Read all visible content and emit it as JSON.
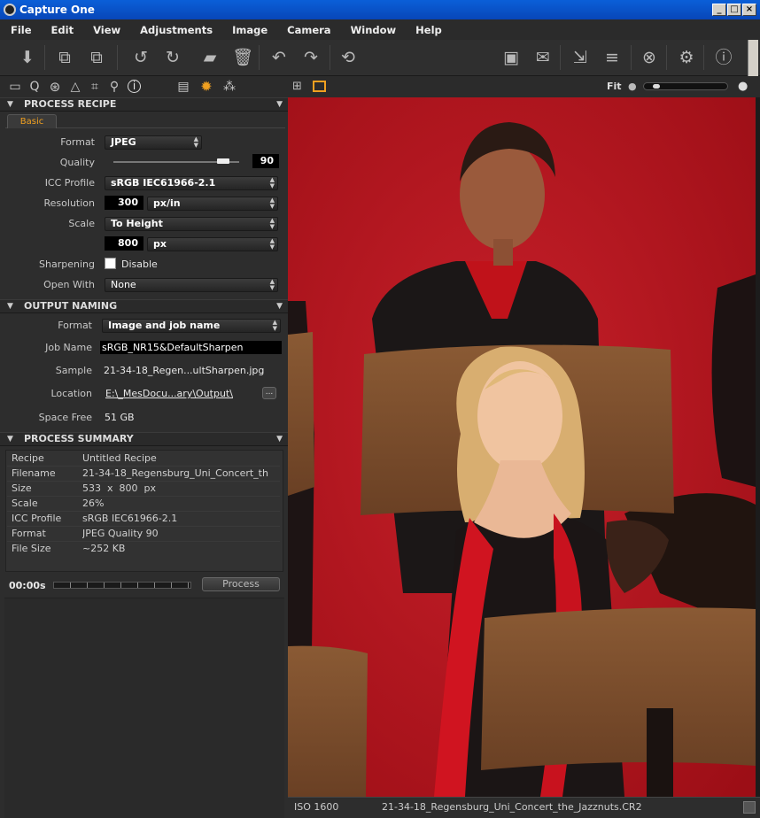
{
  "window": {
    "title": "Capture One"
  },
  "menu": [
    "File",
    "Edit",
    "View",
    "Adjustments",
    "Image",
    "Camera",
    "Window",
    "Help"
  ],
  "viewer": {
    "zoom_label": "Fit",
    "iso": "ISO 1600",
    "filename": "21-34-18_Regensburg_Uni_Concert_the_Jazznuts.CR2"
  },
  "process_recipe": {
    "title": "PROCESS RECIPE",
    "tab": "Basic",
    "format_label": "Format",
    "format_value": "JPEG",
    "quality_label": "Quality",
    "quality_value": "90",
    "icc_label": "ICC Profile",
    "icc_value": "sRGB IEC61966-2.1",
    "resolution_label": "Resolution",
    "resolution_value": "300",
    "resolution_unit": "px/in",
    "scale_label": "Scale",
    "scale_value": "To Height",
    "scale_size": "800",
    "scale_unit": "px",
    "sharpening_label": "Sharpening",
    "sharpening_value": "Disable",
    "openwith_label": "Open With",
    "openwith_value": "None"
  },
  "output_naming": {
    "title": "OUTPUT NAMING",
    "format_label": "Format",
    "format_value": "Image and job name",
    "jobname_label": "Job Name",
    "jobname_value": "sRGB_NR15&DefaultSharpen",
    "sample_label": "Sample",
    "sample_value": "21-34-18_Regen...ultSharpen.jpg",
    "location_label": "Location",
    "location_value": "E:\\_MesDocu...ary\\Output\\",
    "location_button": "...",
    "space_label": "Space Free",
    "space_value": "51 GB"
  },
  "process_summary": {
    "title": "PROCESS SUMMARY",
    "rows": [
      {
        "k": "Recipe",
        "v": "Untitled Recipe"
      },
      {
        "k": "Filename",
        "v": "21-34-18_Regensburg_Uni_Concert_th"
      },
      {
        "k": "Size",
        "v": "533  x  800  px"
      },
      {
        "k": "Scale",
        "v": "26%"
      },
      {
        "k": "ICC Profile",
        "v": "sRGB IEC61966-2.1"
      },
      {
        "k": "Format",
        "v": "JPEG Quality 90"
      },
      {
        "k": "File Size",
        "v": "~252 KB"
      }
    ],
    "time": "00:00s",
    "process_button": "Process"
  },
  "colors": {
    "accent": "#f0a020",
    "titlebar": "#0a5fd8",
    "stage": "#b7121a"
  }
}
